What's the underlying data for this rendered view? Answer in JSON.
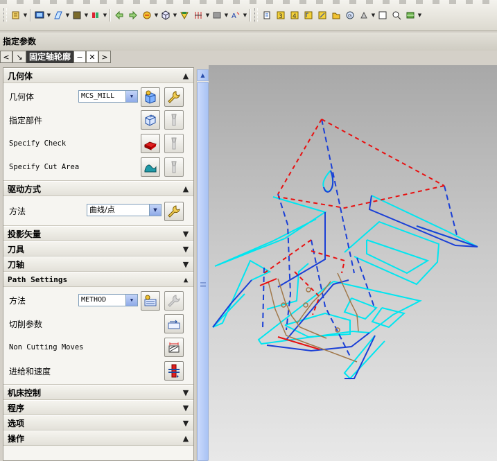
{
  "dialog": {
    "title": "指定参数"
  },
  "tab": {
    "title": "固定轴轮廓",
    "prev": "<",
    "next": ">",
    "minimize": "−",
    "close": "✕",
    "pin": "↘"
  },
  "sections": {
    "geometry": {
      "title": "几何体",
      "rows": {
        "geometry_label": "几何体",
        "geometry_value": "MCS_MILL",
        "part_label": "指定部件",
        "check_label": "Specify Check",
        "cut_area_label": "Specify Cut Area"
      }
    },
    "drive": {
      "title": "驱动方式",
      "method_label": "方法",
      "method_value": "曲线/点"
    },
    "projection": {
      "title": "投影矢量"
    },
    "tool": {
      "title": "刀具"
    },
    "axis": {
      "title": "刀轴"
    },
    "path": {
      "title": "Path Settings",
      "method_label": "方法",
      "method_value": "METHOD",
      "cut_params_label": "切削参数",
      "non_cutting_label": "Non Cutting Moves",
      "feeds_label": "进给和速度"
    },
    "machine": {
      "title": "机床控制"
    },
    "program": {
      "title": "程序"
    },
    "options": {
      "title": "选项"
    },
    "actions": {
      "title": "操作"
    }
  },
  "colors": {
    "wire_cyan": "#00e6f0",
    "wire_blue": "#1a3fd6",
    "wire_red": "#e81010",
    "wire_brown": "#a0784a",
    "tab_dark": "#3a3a3a"
  }
}
